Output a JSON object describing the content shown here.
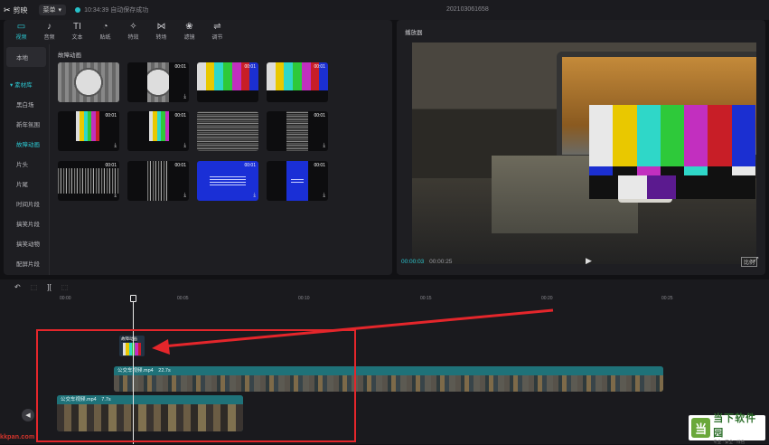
{
  "app": {
    "name": "剪映",
    "menu_label": "菜单",
    "save_status": "10:34:39 自动保存成功",
    "project_name": "202103061658"
  },
  "toolbar": {
    "items": [
      {
        "label": "视频",
        "icon": "▭"
      },
      {
        "label": "音频",
        "icon": "♪"
      },
      {
        "label": "文本",
        "icon": "TI"
      },
      {
        "label": "贴纸",
        "icon": "◔"
      },
      {
        "label": "特效",
        "icon": "✧"
      },
      {
        "label": "转场",
        "icon": "⋈"
      },
      {
        "label": "滤镜",
        "icon": "❀"
      },
      {
        "label": "调节",
        "icon": "⇌"
      }
    ]
  },
  "sidebar": {
    "local": "本地",
    "group": "▾ 素材库",
    "items": [
      "黑白场",
      "新年氛围",
      "故障动画",
      "片头",
      "片尾",
      "时间片段",
      "搞笑片段",
      "搞笑动物",
      "配屏片段"
    ]
  },
  "library": {
    "section_title": "故障动画",
    "durations": [
      "",
      "00:01",
      "00:01",
      "00:01",
      "00:01",
      "00:01",
      "",
      "00:01",
      "00:01",
      "00:01",
      "00:01",
      "00:01"
    ]
  },
  "player": {
    "title": "播放器",
    "current_time": "00:00:03",
    "total_time": "00:00:25",
    "play_icon": "▶",
    "ratio_label": "比例",
    "fullscreen_icon": "⤢"
  },
  "colors": {
    "accent": "#2cc5cf",
    "highlight": "#e4262b",
    "colorbars": [
      "#e8e8e8",
      "#e9c800",
      "#2fd7c8",
      "#2ec93a",
      "#c22fbf",
      "#c81e27",
      "#1b2fd1"
    ],
    "colorbars_mid": [
      "#1b2fd1",
      "#111111",
      "#c22fbf",
      "#111111",
      "#2fd7c8",
      "#111111",
      "#e8e8e8"
    ]
  },
  "timeline": {
    "tools": [
      "↶",
      "⬚",
      "][",
      "⬚"
    ],
    "ticks": [
      "00:00",
      "00:05",
      "00:10",
      "00:15",
      "00:20",
      "00:25"
    ],
    "effect_clip_label": "故障动画",
    "main_clip": {
      "name": "公交车视频.mp4",
      "duration": "22.7s"
    },
    "secondary_clip": {
      "name": "公交车视频.mp4",
      "duration": "7.7s"
    },
    "track_button_icon": "◀"
  },
  "watermarks": {
    "left": "kkpan.com",
    "logo_char": "当",
    "name": "当下软件园",
    "slogan": "专业 · 安全 · 绿色"
  }
}
